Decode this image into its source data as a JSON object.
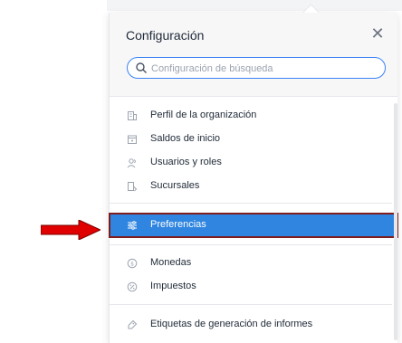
{
  "panel": {
    "title": "Configuración",
    "close_icon": "close-icon"
  },
  "search": {
    "placeholder": "Configuración de búsqueda",
    "value": ""
  },
  "groups": [
    {
      "items": [
        {
          "label": "Perfil de la organización",
          "icon": "building-icon"
        },
        {
          "label": "Saldos de inicio",
          "icon": "calendar-icon"
        },
        {
          "label": "Usuarios y roles",
          "icon": "users-icon"
        },
        {
          "label": "Sucursales",
          "icon": "branch-icon"
        }
      ]
    },
    {
      "items": [
        {
          "label": "Preferencias",
          "icon": "sliders-icon",
          "selected": true
        }
      ]
    },
    {
      "items": [
        {
          "label": "Monedas",
          "icon": "currency-icon"
        },
        {
          "label": "Impuestos",
          "icon": "percent-icon"
        }
      ]
    },
    {
      "items": [
        {
          "label": "Etiquetas de generación de informes",
          "icon": "tag-icon"
        }
      ]
    }
  ],
  "colors": {
    "accent": "#2f85e0",
    "highlight_border": "#7f1d1d",
    "annotation_arrow": "#e00000"
  }
}
